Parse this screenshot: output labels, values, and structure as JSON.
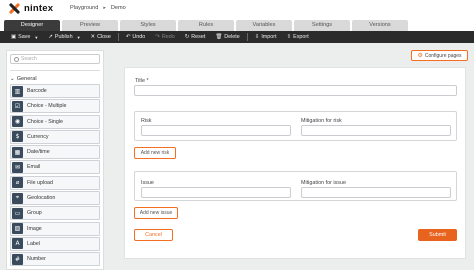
{
  "header": {
    "logo_text": "nintex",
    "breadcrumb": [
      "Playground",
      "Demo"
    ]
  },
  "tabs": [
    {
      "label": "Designer",
      "active": true
    },
    {
      "label": "Preview"
    },
    {
      "label": "Styles"
    },
    {
      "label": "Rules"
    },
    {
      "label": "Variables"
    },
    {
      "label": "Settings"
    },
    {
      "label": "Versions"
    }
  ],
  "toolbar": {
    "save": "Save",
    "publish": "Publish",
    "close": "Close",
    "undo": "Undo",
    "redo": "Redo",
    "reset": "Reset",
    "delete": "Delete",
    "import": "Import",
    "export": "Export"
  },
  "sidebar": {
    "search_placeholder": "Search",
    "section": "General",
    "controls": [
      {
        "label": "Barcode",
        "icon": "barcode-icon",
        "glyph": "▥"
      },
      {
        "label": "Choice - Multiple",
        "icon": "checklist-icon",
        "glyph": "☑"
      },
      {
        "label": "Choice - Single",
        "icon": "radio-list-icon",
        "glyph": "◉"
      },
      {
        "label": "Currency",
        "icon": "currency-icon",
        "glyph": "$"
      },
      {
        "label": "Date/time",
        "icon": "calendar-icon",
        "glyph": "▦"
      },
      {
        "label": "Email",
        "icon": "envelope-icon",
        "glyph": "✉"
      },
      {
        "label": "File upload",
        "icon": "paperclip-icon",
        "glyph": "⌀"
      },
      {
        "label": "Geolocation",
        "icon": "location-icon",
        "glyph": "⌖"
      },
      {
        "label": "Group",
        "icon": "group-icon",
        "glyph": "▭"
      },
      {
        "label": "Image",
        "icon": "image-icon",
        "glyph": "▨"
      },
      {
        "label": "Label",
        "icon": "label-icon",
        "glyph": "A"
      },
      {
        "label": "Number",
        "icon": "number-icon",
        "glyph": "#"
      }
    ]
  },
  "configure_pages": "Configure pages",
  "form": {
    "title_label": "Title *",
    "risk_group": {
      "field_label": "Risk",
      "mitigation_label": "Mitigation for risk",
      "add_label": "Add new risk"
    },
    "issue_group": {
      "field_label": "Issue",
      "mitigation_label": "Mitigation for issue",
      "add_label": "Add new issue"
    },
    "cancel_label": "Cancel",
    "submit_label": "Submit"
  },
  "colors": {
    "accent": "#f36f21",
    "toolbar": "#2b2b2b",
    "active_tab": "#3b3b3b"
  }
}
